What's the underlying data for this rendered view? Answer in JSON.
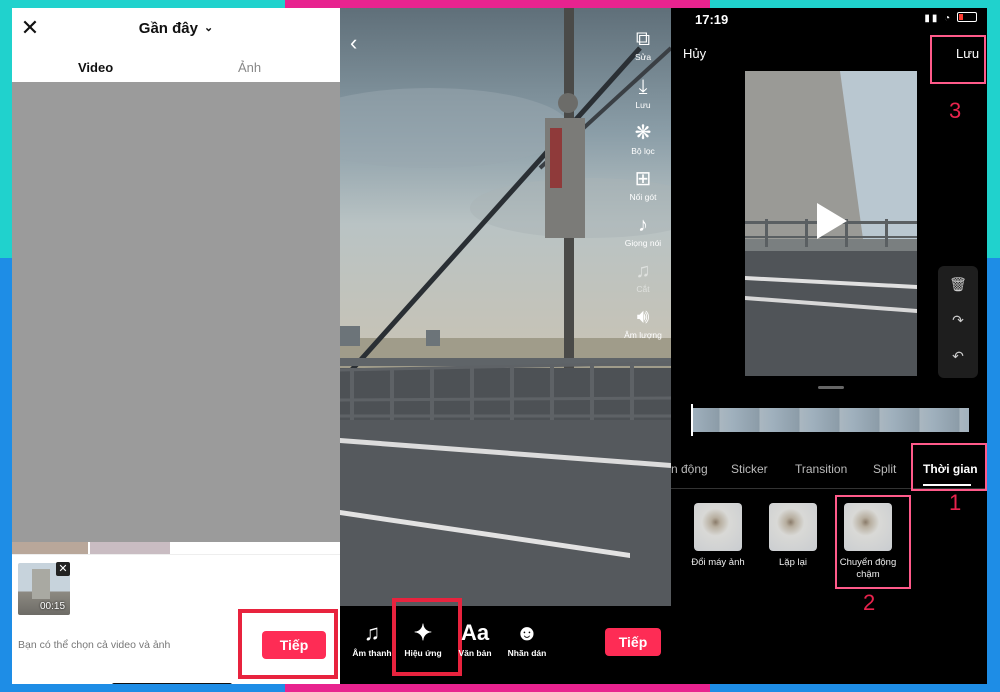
{
  "panel1": {
    "close_icon": "close-icon",
    "title": "Gần đây",
    "tabs": [
      "Video",
      "Ảnh"
    ],
    "selected_clip_duration": "00:15",
    "hint": "Bạn có thể chọn cả video và ảnh",
    "next_label": "Tiếp"
  },
  "panel2": {
    "tools": [
      {
        "label": "Sửa",
        "icon": "edit-icon"
      },
      {
        "label": "Lưu",
        "icon": "download-icon"
      },
      {
        "label": "Bộ lọc",
        "icon": "filter-icon"
      },
      {
        "label": "Nối gót",
        "icon": "stitch-icon"
      },
      {
        "label": "Giọng nói",
        "icon": "voice-icon"
      },
      {
        "label": "Cắt",
        "icon": "trim-icon"
      },
      {
        "label": "Âm lượng",
        "icon": "volume-icon"
      }
    ],
    "bottom": [
      {
        "label": "Âm thanh",
        "icon": "music-icon"
      },
      {
        "label": "Hiệu ứng",
        "icon": "effects-icon"
      },
      {
        "label": "Văn bản",
        "icon": "text-icon",
        "glyph": "Aa"
      },
      {
        "label": "Nhãn dán",
        "icon": "sticker-icon"
      }
    ],
    "next_label": "Tiếp"
  },
  "panel3": {
    "time": "17:19",
    "cancel_label": "Hủy",
    "save_label": "Lưu",
    "step_numbers": [
      "1",
      "2",
      "3"
    ],
    "tabs": [
      "n động",
      "Sticker",
      "Transition",
      "Split",
      "Thời gian"
    ],
    "active_tab": "Thời gian",
    "effects": [
      "Đổi máy ảnh",
      "Lặp lại",
      "Chuyển động chậm"
    ]
  },
  "colors": {
    "accent": "#fe2c55",
    "highlight_box": "#e8233e",
    "annotation_pink": "#ff5a8a"
  }
}
